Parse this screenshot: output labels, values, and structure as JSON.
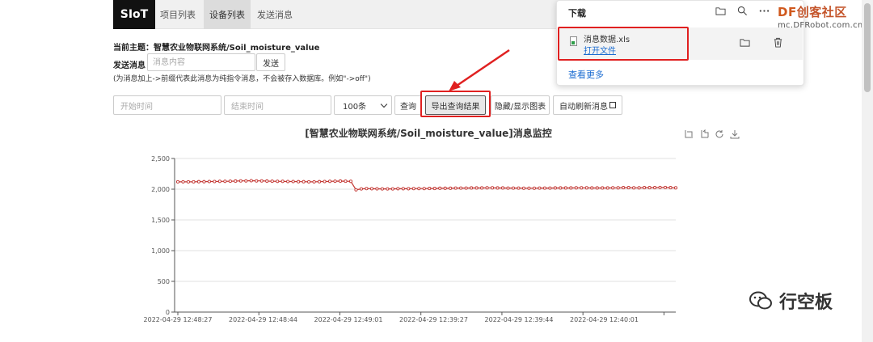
{
  "nav": {
    "brand": "SIoT",
    "tabs": [
      "项目列表",
      "设备列表",
      "发送消息"
    ],
    "active_tab_index": 1
  },
  "topic": "当前主题：智慧农业物联网系统/Soil_moisture_value",
  "send": {
    "label": "发送消息",
    "placeholder": "消息内容",
    "button": "发送",
    "hint": "(为消息加上->前缀代表此消息为纯指令消息，不会被存入数据库。例如\"->off\")"
  },
  "query": {
    "start_placeholder": "开始时间",
    "end_placeholder": "结束时间",
    "limit": "100条",
    "query_button": "查询",
    "export_button": "导出查询结果",
    "toggle_chart_button": "隐藏/显示图表",
    "auto_refresh_label": "自动刷新消息"
  },
  "chart_title": "[智慧农业物联网系统/Soil_moisture_value]消息监控",
  "download_panel": {
    "title": "下载",
    "file_name": "消息数据.xls",
    "open_link": "打开文件",
    "see_more": "查看更多"
  },
  "watermark": {
    "brand_df": "DF",
    "brand_rest": "创客社区",
    "url": "mc.DFRobot.com.cn",
    "wechat_name": "行空板"
  },
  "colors": {
    "series": "#c23531",
    "highlight": "#e02020",
    "link": "#1a6bd0"
  },
  "chart_data": {
    "type": "line",
    "title": "[智慧农业物联网系统/Soil_moisture_value]消息监控",
    "xlabel": "",
    "ylabel": "",
    "ylim": [
      0,
      2500
    ],
    "yticks": [
      0,
      500,
      1000,
      1500,
      2000,
      2500
    ],
    "yticklabels": [
      "0",
      "500",
      "1,000",
      "1,500",
      "2,000",
      "2,500"
    ],
    "xticklabels": [
      "2022-04-29 12:48:27",
      "2022-04-29 12:48:44",
      "2022-04-29 12:49:01",
      "2022-04-29 12:39:27",
      "2022-04-29 12:39:44",
      "2022-04-29 12:40:01"
    ],
    "grid": true,
    "series": [
      {
        "values": [
          2120,
          2120,
          2120,
          2120,
          2122,
          2122,
          2125,
          2125,
          2128,
          2128,
          2130,
          2132,
          2135,
          2135,
          2138,
          2135,
          2135,
          2132,
          2130,
          2128,
          2128,
          2125,
          2125,
          2122,
          2122,
          2120,
          2120,
          2122,
          2125,
          2128,
          2130,
          2132,
          2130,
          2128,
          1990,
          2005,
          2010,
          2008,
          2006,
          2005,
          2005,
          2005,
          2008,
          2008,
          2008,
          2010,
          2010,
          2010,
          2012,
          2012,
          2015,
          2015,
          2015,
          2018,
          2018,
          2018,
          2020,
          2020,
          2020,
          2022,
          2022,
          2020,
          2020,
          2018,
          2018,
          2018,
          2016,
          2016,
          2016,
          2018,
          2018,
          2018,
          2020,
          2020,
          2020,
          2020,
          2022,
          2022,
          2022,
          2020,
          2020,
          2020,
          2020,
          2022,
          2022,
          2025,
          2025,
          2022,
          2022,
          2025,
          2025,
          2025,
          2028,
          2028,
          2025,
          2022
        ]
      }
    ]
  }
}
